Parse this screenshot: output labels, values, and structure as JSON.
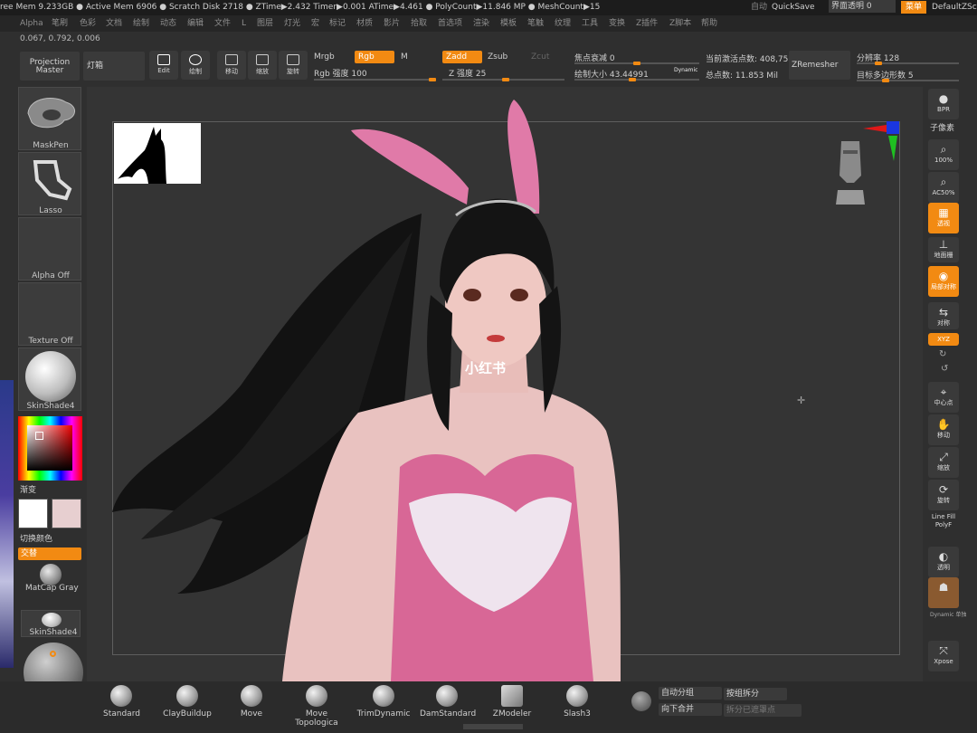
{
  "status_bar": {
    "items": [
      "ree Mem 9.233GB ● Active Mem 6906 ● Scratch Disk 2718 ● ZTime▶2.432 Timer▶0.001 ATime▶4.461 ● PolyCount▶11.846 MP ● MeshCount▶15"
    ],
    "right_items": [
      "自动",
      "QuickSave",
      "界面透明 0",
      "菜单",
      "DefaultZScr"
    ]
  },
  "menu": {
    "items": [
      "Alpha",
      "笔刷",
      "色彩",
      "文档",
      "绘制",
      "动态",
      "编辑",
      "文件",
      "L",
      "图层",
      "灯光",
      "宏",
      "标记",
      "材质",
      "影片",
      "拾取",
      "首选项",
      "渲染",
      "模板",
      "笔触",
      "纹理",
      "工具",
      "变换",
      "Z插件",
      "Z脚本",
      "帮助"
    ]
  },
  "coordinate_readout": "0.067, 0.792, 0.006",
  "toolbar": {
    "projection_master": "Projection Master",
    "lightbox": "灯箱",
    "edit": "Edit",
    "draw": "绘制",
    "move": "移动",
    "scale": "缩放",
    "rotate": "旋转",
    "mrgb": "Mrgb",
    "rgb": "Rgb",
    "m": "M",
    "rgb_intensity": "Rgb 强度 100",
    "zadd": "Zadd",
    "zsub": "Zsub",
    "zcut": "Zcut",
    "z_intensity": "Z 强度 25",
    "focal_shift": "焦点衰减 0",
    "draw_size": "绘制大小 43.44991",
    "dynamic": "Dynamic",
    "active_points": "当前激活点数: 408,750",
    "total_points": "总点数: 11.853 Mil",
    "zremesher": "ZRemesher",
    "resolution": "分辨率 128",
    "target_polys": "目标多边形数 5"
  },
  "left_panel": {
    "tiles": [
      "MaskPen",
      "Lasso",
      "Alpha Off",
      "Texture Off",
      "SkinShade4"
    ],
    "gradient_label": "渐变",
    "switch_color": "切换颜色",
    "alternate": "交替",
    "matcap": "MatCap Gray",
    "skinshade": "SkinShade4",
    "colors": {
      "primary": "#ffffff",
      "secondary": "#e7cfd0"
    }
  },
  "right_panel": {
    "buttons": [
      {
        "icon": "bpr",
        "label": "BPR"
      },
      {
        "icon": "subdiv",
        "label": "子像素"
      },
      {
        "icon": "zoom",
        "label": "100%"
      },
      {
        "icon": "zoom",
        "label": "AC50%"
      },
      {
        "icon": "grid",
        "label": "透视"
      },
      {
        "icon": "floor",
        "label": "地面栅"
      },
      {
        "icon": "local",
        "label": "局部对称"
      },
      {
        "icon": "frame",
        "label": "对称"
      },
      {
        "icon": "xyz",
        "label": "XYZ"
      },
      {
        "icon": "center",
        "label": "中心点"
      },
      {
        "icon": "move",
        "label": "移动"
      },
      {
        "icon": "scale",
        "label": "缩放"
      },
      {
        "icon": "rotate",
        "label": "旋转"
      },
      {
        "icon": "linefill",
        "label": "Line Fill PolyF"
      },
      {
        "icon": "transp",
        "label": "透明"
      },
      {
        "icon": "solo",
        "label": "Dynamic 单独"
      },
      {
        "icon": "xpose",
        "label": "Xpose"
      }
    ]
  },
  "viewport": {
    "watermark": "小红书"
  },
  "bottom": {
    "brushes": [
      "Standard",
      "ClayBuildup",
      "Move",
      "Move Topologica",
      "TrimDynamic",
      "DamStandard",
      "ZModeler",
      "Slash3"
    ],
    "auto_group": "自动分组",
    "split_groups": "按组拆分",
    "merge_down": "向下合并",
    "split_unmasked": "拆分已遮罩点"
  }
}
